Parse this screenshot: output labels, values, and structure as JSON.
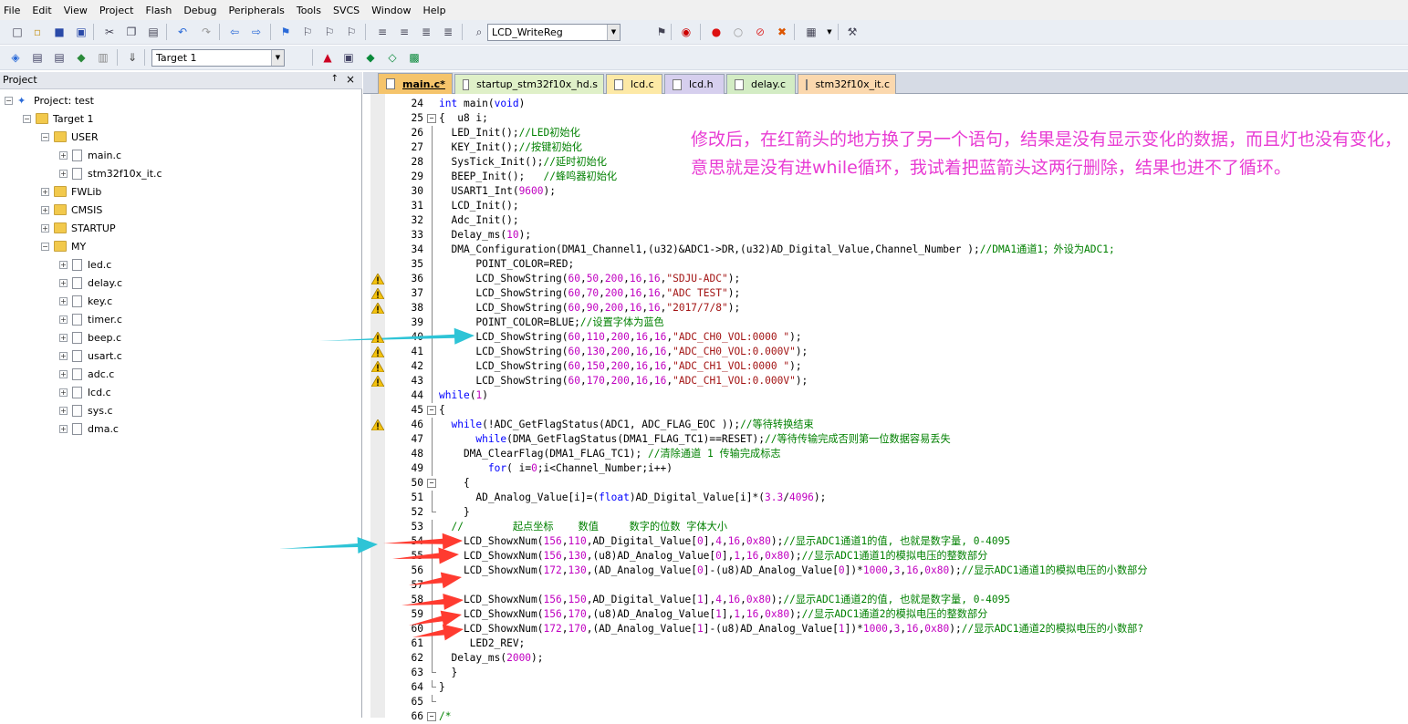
{
  "menu": [
    "File",
    "Edit",
    "View",
    "Project",
    "Flash",
    "Debug",
    "Peripherals",
    "Tools",
    "SVCS",
    "Window",
    "Help"
  ],
  "toolbar": {
    "find_combo": "LCD_WriteReg",
    "target_combo": "Target 1",
    "icons": [
      "new-file-icon",
      "open-folder-icon",
      "save-icon",
      "save-all-icon",
      "cut-icon",
      "copy-icon",
      "paste-icon",
      "undo-icon",
      "redo-icon",
      "nav-back-icon",
      "nav-forward-icon",
      "bookmark-icon",
      "bookmark-prev-icon",
      "bookmark-next-icon",
      "bookmark-clear-icon",
      "indent-icon",
      "unindent-icon",
      "comment-icon",
      "uncomment-icon",
      "find-in-files-icon",
      "incremental-find-icon",
      "debug-start-icon",
      "breakpoint-insert-icon",
      "breakpoint-disable-icon",
      "breakpoint-disable-all-icon",
      "breakpoint-kill-all-icon",
      "window-select-icon",
      "configure-icon"
    ],
    "icons_row2": [
      "translate-icon",
      "build-icon",
      "rebuild-icon",
      "batch-build-icon",
      "stop-build-icon",
      "download-icon",
      "target-options-icon",
      "manage-components-icon",
      "file-extensions-icon",
      "select-pack-icon",
      "run-time-env-icon"
    ]
  },
  "project_pane": {
    "title": "Project",
    "root": "Project: test",
    "target": "Target 1",
    "groups": [
      {
        "name": "USER",
        "files": [
          "main.c",
          "stm32f10x_it.c"
        ]
      },
      {
        "name": "FWLib",
        "files": []
      },
      {
        "name": "CMSIS",
        "files": []
      },
      {
        "name": "STARTUP",
        "files": []
      },
      {
        "name": "MY",
        "files": [
          "led.c",
          "delay.c",
          "key.c",
          "timer.c",
          "beep.c",
          "usart.c",
          "adc.c",
          "lcd.c",
          "sys.c",
          "dma.c"
        ]
      }
    ]
  },
  "tabs": [
    {
      "label": "main.c*",
      "active": true,
      "color": "#f5c46b"
    },
    {
      "label": "startup_stm32f10x_hd.s",
      "active": false,
      "color": "#dff0c8"
    },
    {
      "label": "lcd.c",
      "active": false,
      "color": "#fde9a6"
    },
    {
      "label": "lcd.h",
      "active": false,
      "color": "#d6cfee"
    },
    {
      "label": "delay.c",
      "active": false,
      "color": "#d3ecc4"
    },
    {
      "label": "stm32f10x_it.c",
      "active": false,
      "color": "#fbd8ae"
    }
  ],
  "warning_lines": [
    36,
    37,
    38,
    40,
    41,
    42,
    43,
    46
  ],
  "code": [
    {
      "n": "",
      "f": "",
      "t": "int main(void)"
    },
    {
      "n": "24",
      "f": "",
      "t": "int main(void)"
    },
    {
      "n": "25",
      "f": "box",
      "t": "{  u8 i;"
    },
    {
      "n": "26",
      "f": "line",
      "t": "  LED_Init();//LED初始化"
    },
    {
      "n": "27",
      "f": "line",
      "t": "  KEY_Init();//按键初始化"
    },
    {
      "n": "28",
      "f": "line",
      "t": "  SysTick_Init();//延时初始化"
    },
    {
      "n": "29",
      "f": "line",
      "t": "  BEEP_Init();   //蜂鸣器初始化"
    },
    {
      "n": "30",
      "f": "line",
      "t": "  USART1_Int(9600);"
    },
    {
      "n": "31",
      "f": "line",
      "t": "  LCD_Init();"
    },
    {
      "n": "32",
      "f": "line",
      "t": "  Adc_Init();"
    },
    {
      "n": "33",
      "f": "line",
      "t": "  Delay_ms(10);"
    },
    {
      "n": "34",
      "f": "line",
      "t": "  DMA_Configuration(DMA1_Channel1,(u32)&ADC1->DR,(u32)AD_Digital_Value,Channel_Number );//DMA1通道1；外设为ADC1;"
    },
    {
      "n": "35",
      "f": "line",
      "t": "      POINT_COLOR=RED;"
    },
    {
      "n": "36",
      "f": "line",
      "t": "      LCD_ShowString(60,50,200,16,16,\"SDJU-ADC\");"
    },
    {
      "n": "37",
      "f": "line",
      "t": "      LCD_ShowString(60,70,200,16,16,\"ADC TEST\");"
    },
    {
      "n": "38",
      "f": "line",
      "t": "      LCD_ShowString(60,90,200,16,16,\"2017/7/8\");"
    },
    {
      "n": "39",
      "f": "line",
      "t": "      POINT_COLOR=BLUE;//设置字体为蓝色"
    },
    {
      "n": "40",
      "f": "line",
      "t": "      LCD_ShowString(60,110,200,16,16,\"ADC_CH0_VOL:0000 \");"
    },
    {
      "n": "41",
      "f": "line",
      "t": "      LCD_ShowString(60,130,200,16,16,\"ADC_CH0_VOL:0.000V\");"
    },
    {
      "n": "42",
      "f": "line",
      "t": "      LCD_ShowString(60,150,200,16,16,\"ADC_CH1_VOL:0000 \");"
    },
    {
      "n": "43",
      "f": "line",
      "t": "      LCD_ShowString(60,170,200,16,16,\"ADC_CH1_VOL:0.000V\");"
    },
    {
      "n": "44",
      "f": "line",
      "t": "while(1)"
    },
    {
      "n": "45",
      "f": "box",
      "t": "{"
    },
    {
      "n": "46",
      "f": "line",
      "t": "  while(!ADC_GetFlagStatus(ADC1, ADC_FLAG_EOC ));//等待转换结束"
    },
    {
      "n": "47",
      "f": "line",
      "t": "      while(DMA_GetFlagStatus(DMA1_FLAG_TC1)==RESET);//等待传输完成否则第一位数据容易丢失"
    },
    {
      "n": "48",
      "f": "line",
      "t": "    DMA_ClearFlag(DMA1_FLAG_TC1); //清除通道 1 传输完成标志"
    },
    {
      "n": "49",
      "f": "line",
      "t": "        for( i=0;i<Channel_Number;i++)"
    },
    {
      "n": "50",
      "f": "box",
      "t": "    {"
    },
    {
      "n": "51",
      "f": "line",
      "t": "      AD_Analog_Value[i]=(float)AD_Digital_Value[i]*(3.3/4096);"
    },
    {
      "n": "52",
      "f": "end",
      "t": "    }"
    },
    {
      "n": "53",
      "f": "line",
      "t": "  //        起点坐标    数值     数字的位数 字体大小"
    },
    {
      "n": "54",
      "f": "line",
      "t": "    LCD_ShowxNum(156,110,AD_Digital_Value[0],4,16,0x80);//显示ADC1通道1的值, 也就是数字量, 0-4095"
    },
    {
      "n": "55",
      "f": "line",
      "t": "    LCD_ShowxNum(156,130,(u8)AD_Analog_Value[0],1,16,0x80);//显示ADC1通道1的模拟电压的整数部分"
    },
    {
      "n": "56",
      "f": "line",
      "t": "    LCD_ShowxNum(172,130,(AD_Analog_Value[0]-(u8)AD_Analog_Value[0])*1000,3,16,0x80);//显示ADC1通道1的模拟电压的小数部分"
    },
    {
      "n": "57",
      "f": "line",
      "t": ""
    },
    {
      "n": "58",
      "f": "line",
      "t": "    LCD_ShowxNum(156,150,AD_Digital_Value[1],4,16,0x80);//显示ADC1通道2的值, 也就是数字量, 0-4095"
    },
    {
      "n": "59",
      "f": "line",
      "t": "    LCD_ShowxNum(156,170,(u8)AD_Analog_Value[1],1,16,0x80);//显示ADC1通道2的模拟电压的整数部分"
    },
    {
      "n": "60",
      "f": "line",
      "t": "    LCD_ShowxNum(172,170,(AD_Analog_Value[1]-(u8)AD_Analog_Value[1])*1000,3,16,0x80);//显示ADC1通道2的模拟电压的小数部?"
    },
    {
      "n": "61",
      "f": "line",
      "t": "     LED2_REV;"
    },
    {
      "n": "62",
      "f": "line",
      "t": "  Delay_ms(2000);"
    },
    {
      "n": "63",
      "f": "end",
      "t": "  }"
    },
    {
      "n": "64",
      "f": "end",
      "t": "}"
    },
    {
      "n": "65",
      "f": "end",
      "t": ""
    },
    {
      "n": "66",
      "f": "box",
      "t": "/*"
    }
  ],
  "note": "修改后，在红箭头的地方换了另一个语句，结果是没有显示变化的数据，而且灯也没有变化，意思就是没有进while循环，我试着把蓝箭头这两行删除，结果也进不了循环。",
  "colors": {
    "red_arrow": "#ff3b30",
    "blue_arrow": "#2ec4d6",
    "note": "#e83cd3"
  }
}
